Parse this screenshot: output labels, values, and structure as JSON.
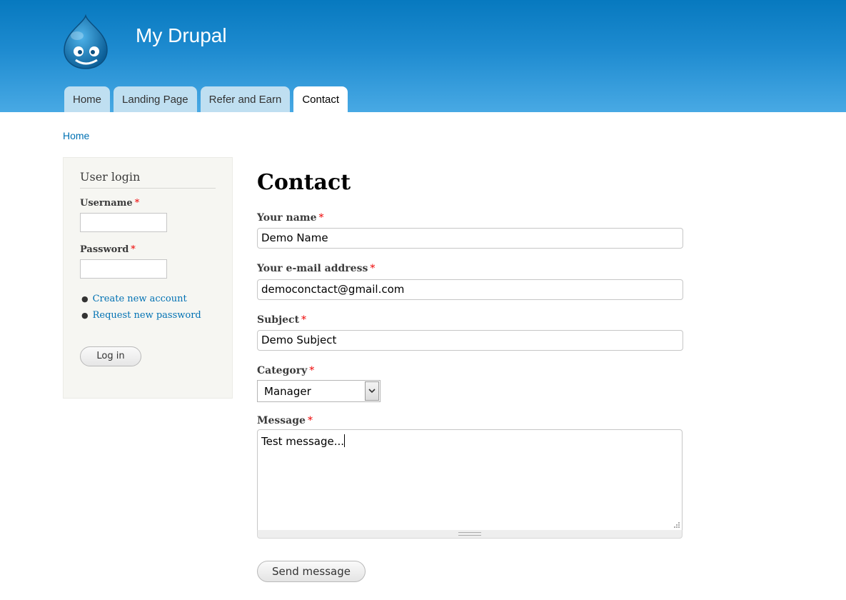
{
  "site": {
    "name": "My Drupal",
    "logo_icon": "drupal-drop-logo"
  },
  "nav": {
    "tabs": [
      {
        "label": "Home"
      },
      {
        "label": "Landing Page"
      },
      {
        "label": "Refer and Earn"
      },
      {
        "label": "Contact",
        "active": true
      }
    ]
  },
  "breadcrumb": {
    "home": "Home"
  },
  "sidebar": {
    "title": "User login",
    "username_label": "Username",
    "password_label": "Password",
    "required_marker": "*",
    "username_value": "",
    "password_value": "",
    "links": [
      "Create new account",
      "Request new password"
    ],
    "login_button": "Log in"
  },
  "contact": {
    "title": "Contact",
    "name_label": "Your name",
    "name_value": "Demo Name",
    "email_label": "Your e-mail address",
    "email_value": "democonctact@gmail.com",
    "subject_label": "Subject",
    "subject_value": "Demo Subject",
    "category_label": "Category",
    "category_value": "Manager",
    "message_label": "Message",
    "message_value": "Test message...",
    "send_button": "Send message"
  },
  "colors": {
    "header_top": "#0779bf",
    "header_bottom": "#48a9e4",
    "tab_inactive": "#bfdff1",
    "link": "#0071b3",
    "required": "#e00000",
    "sidebar_bg": "#f6f6f2"
  }
}
